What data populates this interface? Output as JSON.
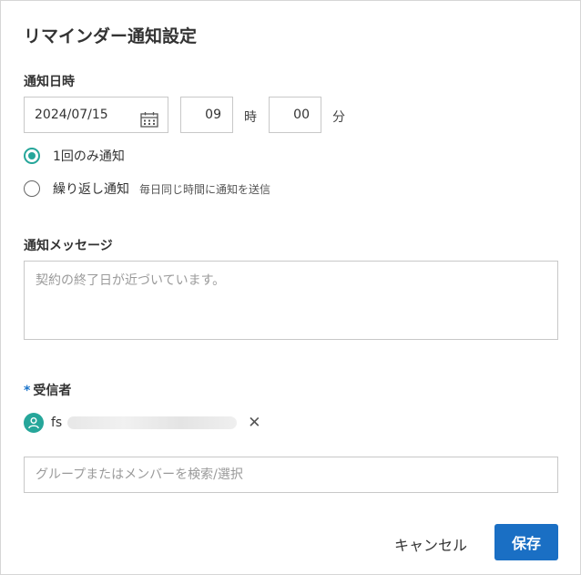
{
  "dialog": {
    "title": "リマインダー通知設定"
  },
  "datetime": {
    "label": "通知日時",
    "date": "2024/07/15",
    "hour": "09",
    "hour_unit": "時",
    "minute": "00",
    "minute_unit": "分"
  },
  "frequency": {
    "once_label": "1回のみ通知",
    "once_selected": true,
    "repeat_label": "繰り返し通知",
    "repeat_hint": "毎日同じ時間に通知を送信",
    "repeat_selected": false
  },
  "message": {
    "label": "通知メッセージ",
    "placeholder": "契約の終了日が近づいています。"
  },
  "recipients": {
    "required_mark": "*",
    "label": "受信者",
    "items": [
      {
        "name": "fs"
      }
    ],
    "search_placeholder": "グループまたはメンバーを検索/選択"
  },
  "footer": {
    "cancel_label": "キャンセル",
    "save_label": "保存"
  },
  "colors": {
    "accent_teal": "#26a69a",
    "primary_blue": "#1a6fc4"
  },
  "icons": {
    "date": "calendar-icon",
    "avatar": "user-icon",
    "remove": "close-icon"
  }
}
